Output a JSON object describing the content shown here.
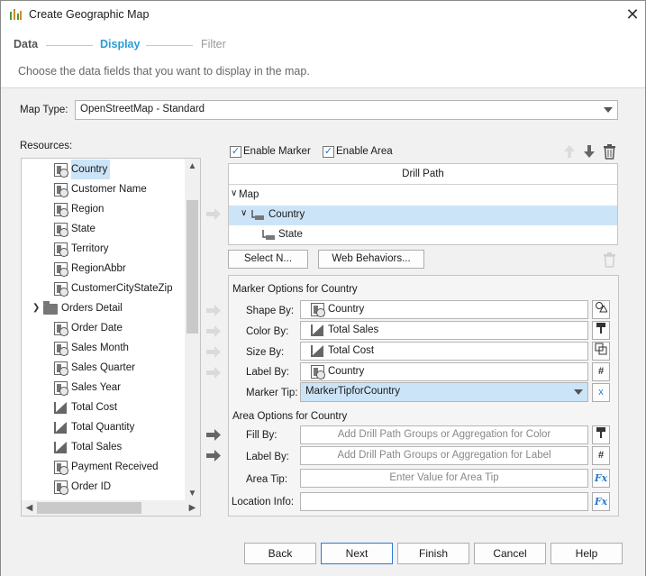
{
  "window": {
    "title": "Create Geographic Map",
    "close": "✕"
  },
  "wizard": {
    "steps": [
      {
        "label": "Data",
        "state": "done"
      },
      {
        "label": "Display",
        "state": "active"
      },
      {
        "label": "Filter",
        "state": "todo"
      }
    ],
    "instruction": "Choose the data fields that you want to display in the map."
  },
  "map_type": {
    "label": "Map Type:",
    "value": "OpenStreetMap - Standard"
  },
  "resources": {
    "label": "Resources:",
    "items": [
      {
        "label": "Country",
        "icon": "dimension-icon",
        "selected": true
      },
      {
        "label": "Customer Name",
        "icon": "field-icon"
      },
      {
        "label": "Region",
        "icon": "dimension-icon"
      },
      {
        "label": "State",
        "icon": "dimension-icon"
      },
      {
        "label": "Territory",
        "icon": "field-icon"
      },
      {
        "label": "RegionAbbr",
        "icon": "dimension-icon"
      },
      {
        "label": "CustomerCityStateZip",
        "icon": "dimension-icon"
      },
      {
        "label": "Orders Detail",
        "icon": "folder-icon",
        "expanded": true
      },
      {
        "label": "Order Date",
        "icon": "field-icon"
      },
      {
        "label": "Sales Month",
        "icon": "field-icon"
      },
      {
        "label": "Sales Quarter",
        "icon": "field-icon"
      },
      {
        "label": "Sales Year",
        "icon": "field-icon"
      },
      {
        "label": "Total Cost",
        "icon": "measure-icon"
      },
      {
        "label": "Total Quantity",
        "icon": "measure-icon"
      },
      {
        "label": "Total Sales",
        "icon": "measure-icon"
      },
      {
        "label": "Payment Received",
        "icon": "field-icon"
      },
      {
        "label": "Order ID",
        "icon": "field-icon"
      }
    ]
  },
  "options": {
    "enable_marker": "Enable Marker",
    "enable_area": "Enable Area"
  },
  "drill_path": {
    "header": "Drill Path",
    "rows": [
      {
        "label": "Map"
      },
      {
        "label": "Country",
        "selected": true
      },
      {
        "label": "State"
      }
    ],
    "select_button": "Select N...",
    "web_behaviors_button": "Web Behaviors..."
  },
  "marker": {
    "title": "Marker Options for Country",
    "shape_label": "Shape By:",
    "shape_value": "Country",
    "color_label": "Color By:",
    "color_value": "Total Sales",
    "size_label": "Size By:",
    "size_value": "Total Cost",
    "label_label": "Label By:",
    "label_value": "Country",
    "tip_label": "Marker Tip:",
    "tip_value": "MarkerTipforCountry",
    "x": "x"
  },
  "area": {
    "title": "Area Options for Country",
    "fill_label": "Fill By:",
    "fill_placeholder": "Add Drill Path Groups or Aggregation for Color",
    "label_label": "Label By:",
    "label_placeholder": "Add Drill Path Groups or Aggregation for Label",
    "tip_label": "Area Tip:",
    "tip_placeholder": "Enter Value for Area Tip"
  },
  "location": {
    "label": "Location Info:"
  },
  "fx": "Fx",
  "hash": "#",
  "footer": {
    "back": "Back",
    "next": "Next",
    "finish": "Finish",
    "cancel": "Cancel",
    "help": "Help"
  }
}
